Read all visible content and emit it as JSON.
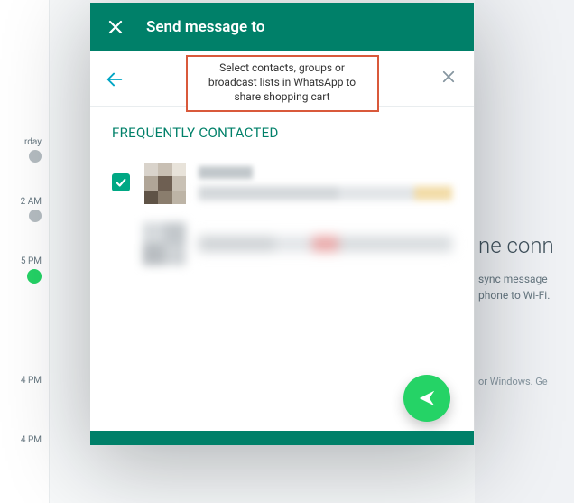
{
  "colors": {
    "teal": "#008069",
    "tealLight": "#00a884",
    "green": "#25d366",
    "calloutBorder": "#d9593b"
  },
  "header": {
    "title": "Send message to"
  },
  "callout": {
    "text": "Select contacts, groups or broadcast lists in WhatsApp to share shopping cart"
  },
  "section": {
    "frequentlyContacted": "FREQUENTLY CONTACTED"
  },
  "background": {
    "times": [
      "rday",
      "2 AM",
      "5 PM",
      "4 PM",
      "4 PM"
    ],
    "rightTitle": "ne conn",
    "rightSub1": "sync message",
    "rightSub2": "phone to Wi-Fi.",
    "rightHint": "or Windows. Ge"
  }
}
